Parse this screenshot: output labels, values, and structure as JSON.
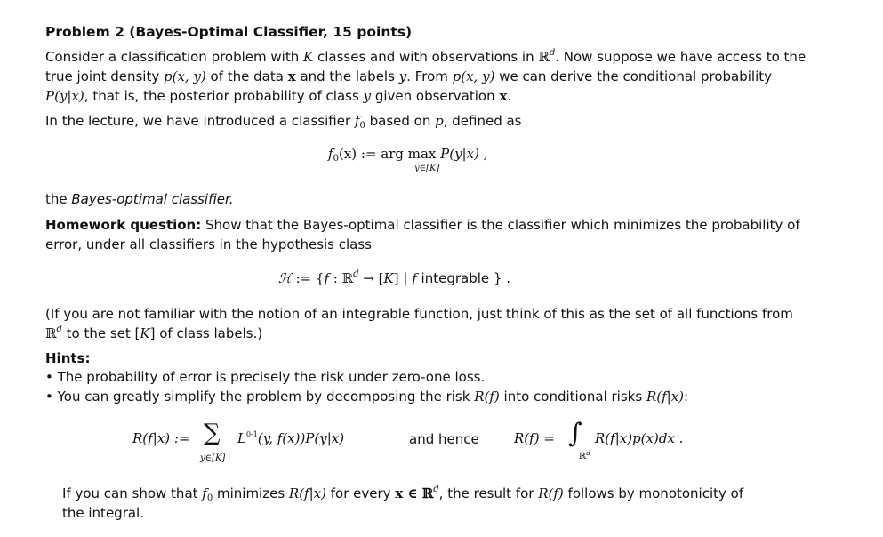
{
  "title": "Problem 2 (Bayes-Optimal Classifier, 15 points)",
  "intro": {
    "l1_a": "Consider a classification problem with ",
    "l1_K": "K",
    "l1_b": " classes and with observations in ",
    "l1_R": "ℝ",
    "l1_d": "d",
    "l1_c": ". Now suppose we have access to the",
    "l2_a": "true joint density ",
    "l2_pxy": "p(x, y)",
    "l2_b": " of the data ",
    "l2_x": "x",
    "l2_c": " and the labels ",
    "l2_y": "y",
    "l2_d": ". From ",
    "l2_pxy2": "p(x, y)",
    "l2_e": " we can derive the conditional probability",
    "l3_P": "P(y|x)",
    "l3_a": ", that is, the posterior probability of class ",
    "l3_y": "y",
    "l3_b": " given observation ",
    "l3_x": "x",
    "l3_c": "."
  },
  "lecture": {
    "a": "In the lecture, we have introduced a classifier ",
    "f": "f",
    "f_sub": "0",
    "b": " based on ",
    "p": "p",
    "c": ", defined as"
  },
  "eq1": {
    "lhs": "f",
    "lhs_sub": "0",
    "lhs_arg": "(x) := arg max ",
    "rhs": "P(y|x) ,",
    "under": "y∈[K]"
  },
  "bayes": {
    "a": "the ",
    "b": "Bayes-optimal classifier."
  },
  "homework": {
    "label": "Homework question:",
    "l1": " Show that the Bayes-optimal classifier is the classifier which minimizes the probability of",
    "l2": "error, under all classifiers in the hypothesis class"
  },
  "eq2": {
    "H": "ℋ",
    "a": " := {",
    "f": "f",
    "b": " : ℝ",
    "d": "d",
    "c": " → [",
    "K": "K",
    "e": "] | ",
    "f2": "f",
    "g": " integrable } ."
  },
  "note": {
    "l1": "(If you are not familiar with the notion of an integrable function, just think of this as the set of all functions from",
    "l2_R": "ℝ",
    "l2_d": "d",
    "l2_a": " to the set [",
    "l2_K": "K",
    "l2_b": "] of class labels.)"
  },
  "hints": {
    "heading": "Hints:",
    "bullet": "•",
    "h1": "The probability of error is precisely the risk under zero-one loss.",
    "h2_a": "You can greatly simplify the problem by decomposing the risk ",
    "h2_Rf": "R(f)",
    "h2_b": " into conditional risks ",
    "h2_Rfx": "R(f|x)",
    "h2_c": ":"
  },
  "eq3": {
    "lhs": "R(f|x) :=",
    "sum": "∑",
    "under": "y∈[K]",
    "L": "L",
    "L_sup": "0-1",
    "rhs": "(y, f(x))P(y|x)",
    "mid": "and hence",
    "r_lhs": "R(f) =",
    "int": "∫",
    "int_under": "ℝ",
    "int_under_sup": "d",
    "r_rhs": "R(f|x)p(x)dx ."
  },
  "conclusion": {
    "a": "If you can show that ",
    "f": "f",
    "f_sub": "0",
    "b": " minimizes ",
    "Rfx": "R(f|x)",
    "c": " for every ",
    "x": "x ∈ ℝ",
    "d": "d",
    "e": ", the result for ",
    "Rf": "R(f)",
    "g": " follows by monotonicity of",
    "l2": "the integral."
  }
}
